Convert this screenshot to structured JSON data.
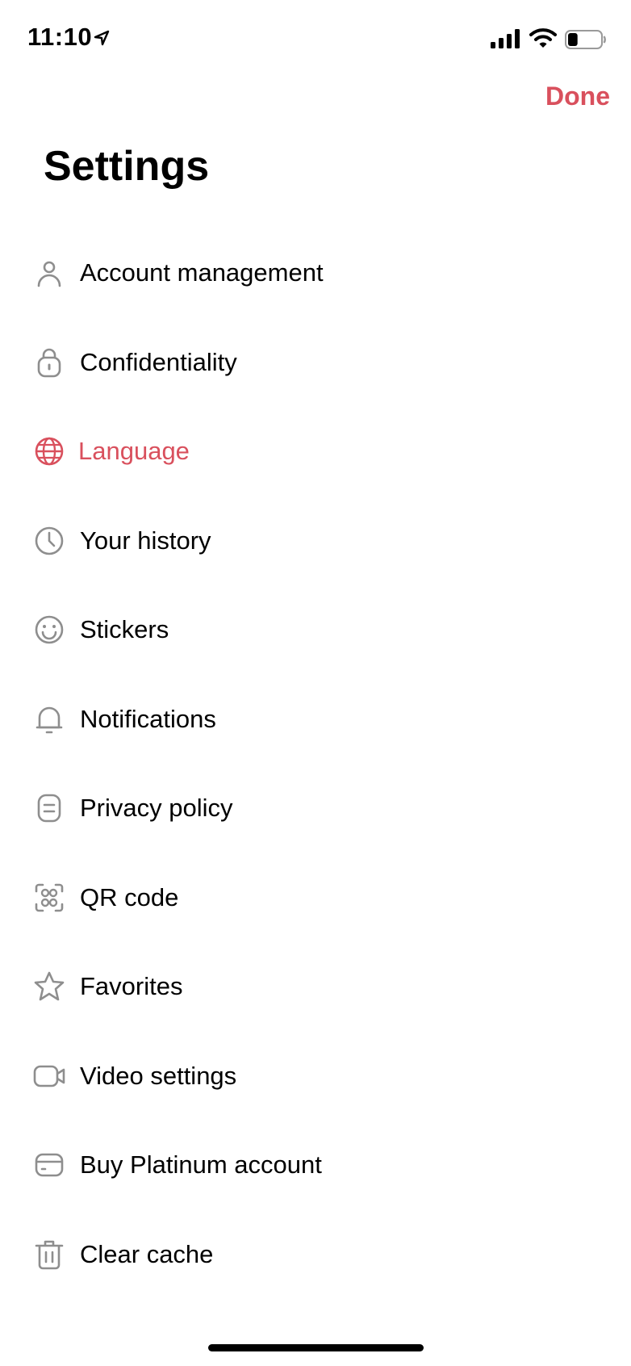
{
  "status_bar": {
    "time": "11:10",
    "battery_level": 0.3
  },
  "header": {
    "done_label": "Done",
    "title": "Settings"
  },
  "colors": {
    "accent": "#d9505d",
    "icon_gray": "#8e8e8e",
    "text": "#000000"
  },
  "menu": {
    "items": [
      {
        "label": "Account management",
        "icon": "person-icon",
        "active": false
      },
      {
        "label": "Confidentiality",
        "icon": "lock-icon",
        "active": false
      },
      {
        "label": "Language",
        "icon": "globe-icon",
        "active": true
      },
      {
        "label": "Your history",
        "icon": "clock-icon",
        "active": false
      },
      {
        "label": "Stickers",
        "icon": "smiley-icon",
        "active": false
      },
      {
        "label": "Notifications",
        "icon": "bell-icon",
        "active": false
      },
      {
        "label": "Privacy policy",
        "icon": "document-icon",
        "active": false
      },
      {
        "label": "QR code",
        "icon": "qr-scan-icon",
        "active": false
      },
      {
        "label": "Favorites",
        "icon": "star-icon",
        "active": false
      },
      {
        "label": "Video settings",
        "icon": "video-camera-icon",
        "active": false
      },
      {
        "label": "Buy Platinum account",
        "icon": "card-icon",
        "active": false
      },
      {
        "label": "Clear cache",
        "icon": "trash-icon",
        "active": false
      }
    ]
  }
}
